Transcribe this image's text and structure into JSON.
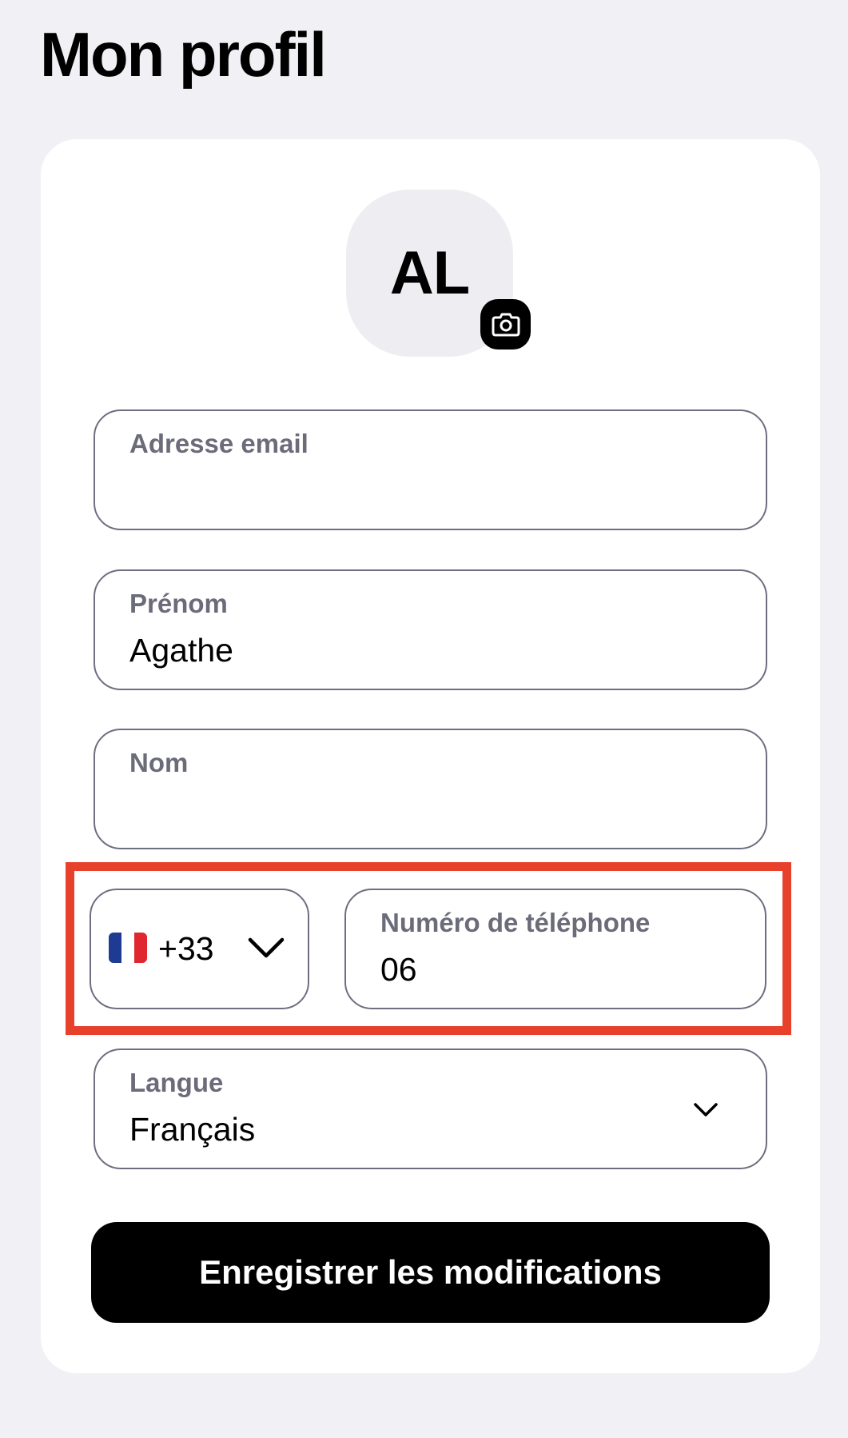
{
  "page": {
    "title": "Mon profil"
  },
  "avatar": {
    "initials": "AL",
    "edit_icon": "camera-icon"
  },
  "fields": {
    "email": {
      "label": "Adresse email",
      "value": ""
    },
    "prenom": {
      "label": "Prénom",
      "value": "Agathe"
    },
    "nom": {
      "label": "Nom",
      "value": ""
    },
    "country": {
      "flag": "france-flag-icon",
      "code": "+33",
      "icon": "chevron-down-icon"
    },
    "phone": {
      "label": "Numéro de téléphone",
      "value": "06"
    },
    "langue": {
      "label": "Langue",
      "value": "Français",
      "icon": "chevron-down-icon"
    }
  },
  "actions": {
    "save_label": "Enregistrer les modifications"
  },
  "colors": {
    "background": "#f1f1f5",
    "card": "#ffffff",
    "field_border": "#6e6e80",
    "label": "#6b6b79",
    "primary_button": "#000000",
    "highlight": "#e8412b"
  }
}
